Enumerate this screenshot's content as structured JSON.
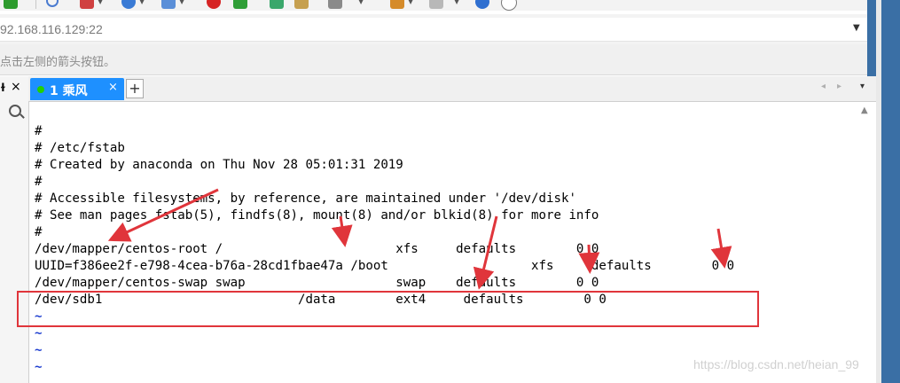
{
  "address_bar": {
    "value": "92.168.116.129:22"
  },
  "hint_bar": {
    "text": "点击左侧的箭头按钮。"
  },
  "left_panel": {
    "pin_glyph": "ɫ",
    "close_glyph": "×"
  },
  "tabs": [
    {
      "label": "1 乘风",
      "active": true,
      "status_color": "#23d100",
      "close_glyph": "×"
    }
  ],
  "tab_add_glyph": "+",
  "tab_nav": {
    "prev": "◂",
    "next": "▸",
    "menu": "▾"
  },
  "terminal": {
    "lines": [
      "#",
      "# /etc/fstab",
      "# Created by anaconda on Thu Nov 28 05:01:31 2019",
      "#",
      "# Accessible filesystems, by reference, are maintained under '/dev/disk'",
      "# See man pages fstab(5), findfs(8), mount(8) and/or blkid(8) for more info",
      "#",
      "/dev/mapper/centos-root /                       xfs     defaults        0 0",
      "UUID=f386ee2f-e798-4cea-b76a-28cd1fbae47a /boot                   xfs     defaults        0 0",
      "/dev/mapper/centos-swap swap                    swap    defaults        0 0",
      "/dev/sdb1                          /data        ext4     defaults        0 0",
      "~",
      "~",
      "~",
      "~"
    ]
  },
  "annotation": {
    "color": "#e0353b"
  },
  "watermark": "https://blog.csdn.net/heian_99"
}
